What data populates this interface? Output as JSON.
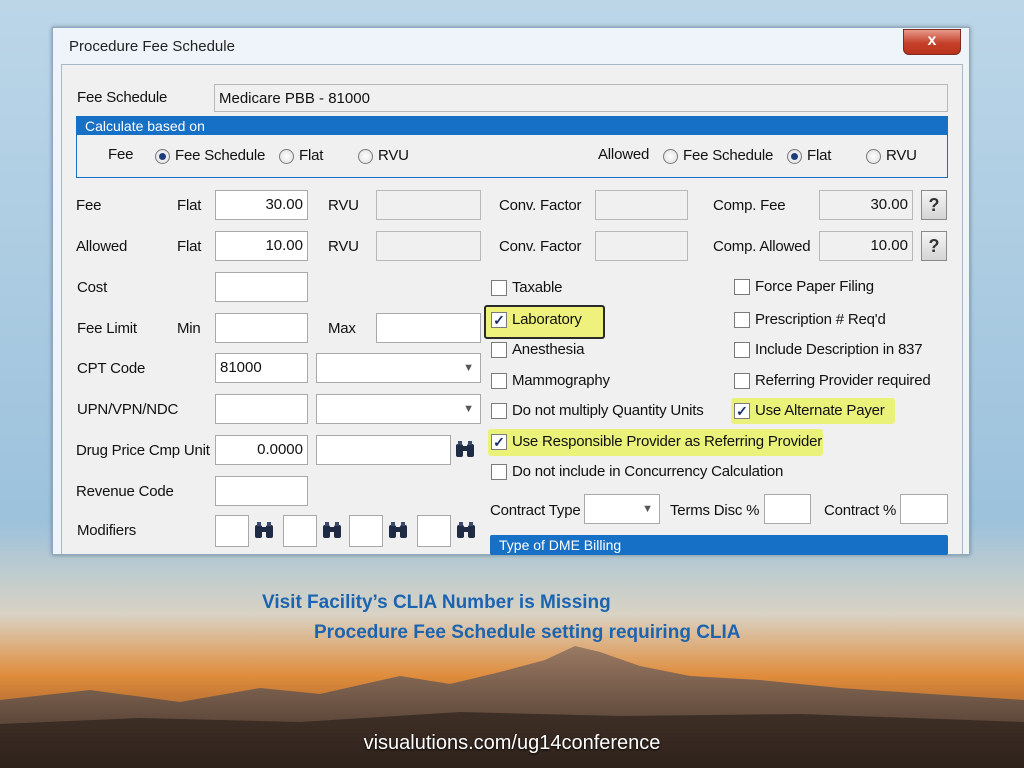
{
  "window": {
    "title": "Procedure Fee Schedule",
    "close_label": "x"
  },
  "fee_schedule": {
    "label": "Fee Schedule",
    "value": "Medicare PBB - 81000"
  },
  "calculate": {
    "header": "Calculate based on",
    "fee_label": "Fee",
    "fee_options": [
      "Fee Schedule",
      "Flat",
      "RVU"
    ],
    "fee_selected": "Fee Schedule",
    "allowed_label": "Allowed",
    "allowed_options": [
      "Fee Schedule",
      "Flat",
      "RVU"
    ],
    "allowed_selected": "Flat"
  },
  "rows": {
    "fee": {
      "label": "Fee",
      "mode": "Flat",
      "value": "30.00",
      "rvu_label": "RVU",
      "conv_label": "Conv. Factor",
      "comp_label": "Comp. Fee",
      "comp_value": "30.00"
    },
    "allowed": {
      "label": "Allowed",
      "mode": "Flat",
      "value": "10.00",
      "rvu_label": "RVU",
      "conv_label": "Conv. Factor",
      "comp_label": "Comp. Allowed",
      "comp_value": "10.00"
    },
    "cost": {
      "label": "Cost",
      "value": ""
    },
    "fee_limit": {
      "label": "Fee Limit",
      "min_label": "Min",
      "max_label": "Max"
    },
    "cpt": {
      "label": "CPT Code",
      "value": "81000"
    },
    "upn": {
      "label": "UPN/VPN/NDC",
      "value": ""
    },
    "drug": {
      "label": "Drug Price Cmp Unit",
      "value": "0.0000"
    },
    "revenue": {
      "label": "Revenue Code",
      "value": ""
    },
    "modifiers": {
      "label": "Modifiers"
    }
  },
  "help_label": "?",
  "checkboxes_left": [
    {
      "label": "Taxable",
      "checked": false
    },
    {
      "label": "Laboratory",
      "checked": true
    },
    {
      "label": "Anesthesia",
      "checked": false
    },
    {
      "label": "Mammography",
      "checked": false
    },
    {
      "label": "Do not multiply Quantity Units",
      "checked": false
    },
    {
      "label": "Use Responsible Provider as Referring Provider",
      "checked": true
    },
    {
      "label": "Do not include in Concurrency Calculation",
      "checked": false
    }
  ],
  "checkboxes_right": [
    {
      "label": "Force Paper Filing",
      "checked": false
    },
    {
      "label": "Prescription # Req'd",
      "checked": false
    },
    {
      "label": "Include Description in 837",
      "checked": false
    },
    {
      "label": "Referring Provider required",
      "checked": false
    },
    {
      "label": "Use Alternate Payer",
      "checked": true
    }
  ],
  "contract": {
    "type_label": "Contract Type",
    "terms_label": "Terms Disc %",
    "pct_label": "Contract %"
  },
  "dme_header": "Type of DME Billing",
  "captions": {
    "line1": "Visit Facility’s CLIA Number is Missing",
    "line2": "Procedure Fee Schedule setting requiring CLIA"
  },
  "footer_url": "visualutions.com/ug14conference",
  "colors": {
    "accent": "#1570c6",
    "highlight": "#eaf27a",
    "caption": "#1c64b0"
  }
}
